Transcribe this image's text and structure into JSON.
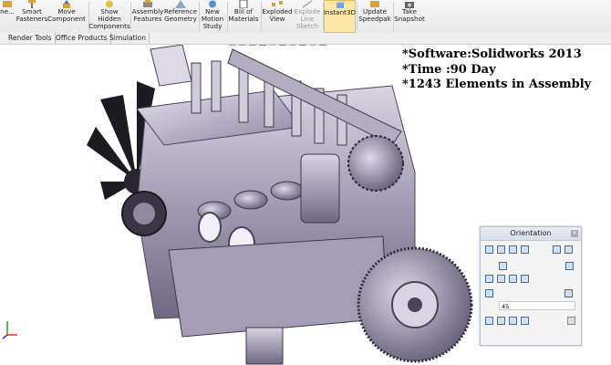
{
  "toolbar": {
    "buttons": [
      {
        "label": "ne...",
        "icon": "edit-component-icon"
      },
      {
        "label": "Smart\nFasteners",
        "icon": "smart-fasteners-icon"
      },
      {
        "label": "Move\nComponent",
        "icon": "move-component-icon"
      },
      {
        "label": "Show\nHidden\nComponents",
        "icon": "show-hidden-icon"
      },
      {
        "label": "Assembly\nFeatures",
        "icon": "assembly-features-icon"
      },
      {
        "label": "Reference\nGeometry",
        "icon": "reference-geometry-icon"
      },
      {
        "label": "New\nMotion\nStudy",
        "icon": "motion-study-icon"
      },
      {
        "label": "Bill of\nMaterials",
        "icon": "bom-icon"
      },
      {
        "label": "Exploded\nView",
        "icon": "exploded-view-icon"
      },
      {
        "label": "Explode\nLine\nSketch",
        "icon": "explode-line-icon",
        "disabled": true
      },
      {
        "label": "Instant3D",
        "icon": "instant3d-icon",
        "active": true
      },
      {
        "label": "Update\nSpeedpak",
        "icon": "speedpak-icon"
      },
      {
        "label": "Take\nSnapshot",
        "icon": "snapshot-icon"
      }
    ]
  },
  "tabs": [
    "Render Tools",
    "Office Products",
    "Simulation"
  ],
  "overlay": {
    "line1": "*Software:Solidworks 2013",
    "line2": "*Time :90 Day",
    "line3": "*1243 Elements in Assembly"
  },
  "orientation": {
    "title": "Orientation",
    "value": "45"
  },
  "colors": {
    "engine_body": "#c9c4d6",
    "engine_shadow": "#6e6680",
    "engine_dark": "#2a2630",
    "accent_active": "#fbe7a6"
  }
}
